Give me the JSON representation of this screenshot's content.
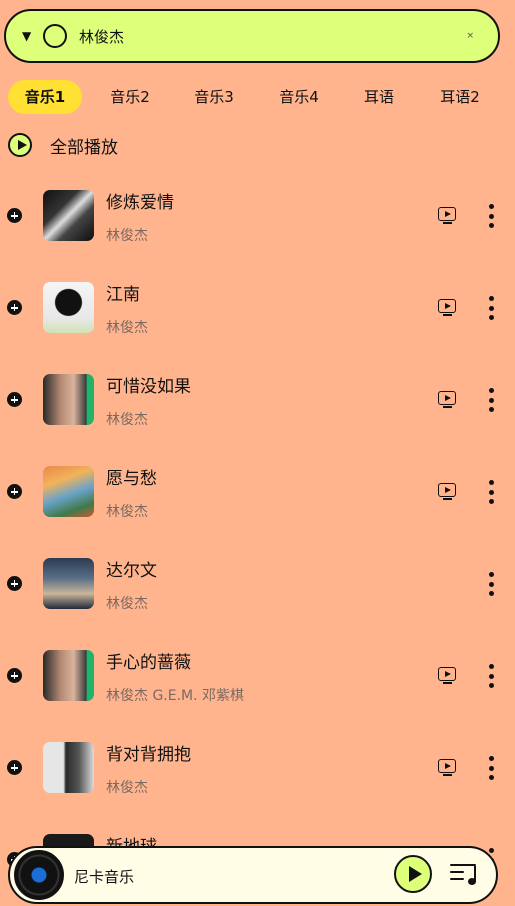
{
  "search": {
    "query": "林俊杰",
    "clear_glyph": "×"
  },
  "tabs": [
    {
      "label": "音乐1",
      "active": true
    },
    {
      "label": "音乐2",
      "active": false
    },
    {
      "label": "音乐3",
      "active": false
    },
    {
      "label": "音乐4",
      "active": false
    },
    {
      "label": "耳语",
      "active": false
    },
    {
      "label": "耳语2",
      "active": false
    }
  ],
  "play_all": {
    "label": "全部播放"
  },
  "songs": [
    {
      "title": "修炼爱情",
      "artist": "林俊杰",
      "has_mv": true
    },
    {
      "title": "江南",
      "artist": "林俊杰",
      "has_mv": true
    },
    {
      "title": "可惜没如果",
      "artist": "林俊杰",
      "has_mv": true
    },
    {
      "title": "愿与愁",
      "artist": "林俊杰",
      "has_mv": true
    },
    {
      "title": "达尔文",
      "artist": "林俊杰",
      "has_mv": false
    },
    {
      "title": "手心的蔷薇",
      "artist": "林俊杰 G.E.M. 邓紫棋",
      "has_mv": true
    },
    {
      "title": "背对背拥抱",
      "artist": "林俊杰",
      "has_mv": true
    },
    {
      "title": "新地球",
      "artist": "",
      "has_mv": false
    }
  ],
  "player": {
    "title": "尼卡音乐"
  },
  "colors": {
    "background": "#FFB48D",
    "accent_green": "#DDFF7A",
    "active_tab": "#FFE033",
    "player_bg": "#FFFDE6"
  },
  "icons": {
    "dropdown": "dropdown-triangle-icon",
    "circle": "circle-icon",
    "clear": "close-icon",
    "play": "play-icon",
    "add": "add-circle-icon",
    "mv": "mv-video-icon",
    "more": "more-vertical-icon",
    "disc": "vinyl-disc-icon",
    "playlist": "playlist-icon"
  }
}
